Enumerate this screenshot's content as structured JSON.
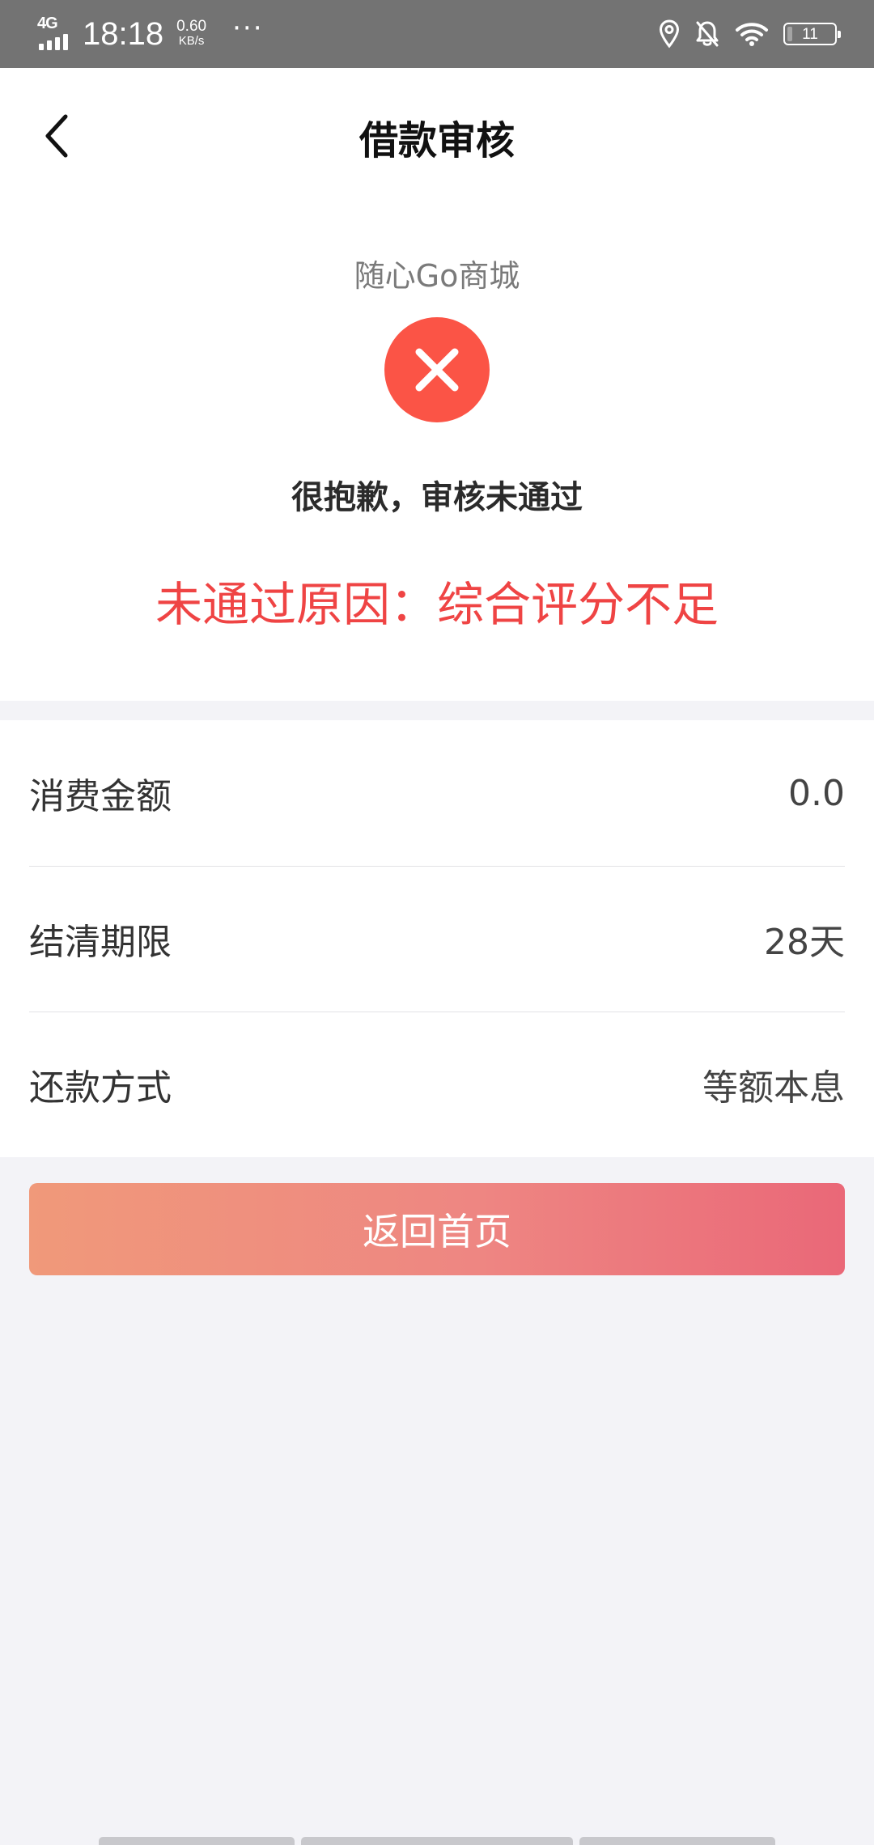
{
  "status_bar": {
    "network": "4G",
    "time": "18:18",
    "speed_value": "0.60",
    "speed_unit": "KB/s",
    "more": "···",
    "battery_level": "11",
    "battery_fraction": 0.11,
    "icons": [
      "location-icon",
      "bell-off-icon",
      "wifi-icon",
      "battery-icon"
    ],
    "color": "#737373"
  },
  "header": {
    "title": "借款审核",
    "back_icon": "chevron-left-icon"
  },
  "result": {
    "merchant": "随心Go商城",
    "status_icon": "close-circle-icon",
    "status_color": "#fb5446",
    "title": "很抱歉，审核未通过",
    "reason": "未通过原因：综合评分不足",
    "reason_color": "#ef4444"
  },
  "details": [
    {
      "label": "消费金额",
      "value": "0.0"
    },
    {
      "label": "结清期限",
      "value": "28天"
    },
    {
      "label": "还款方式",
      "value": "等额本息"
    }
  ],
  "actions": {
    "home_label": "返回首页",
    "gradient_start": "#f0997a",
    "gradient_end": "#ea6878"
  }
}
